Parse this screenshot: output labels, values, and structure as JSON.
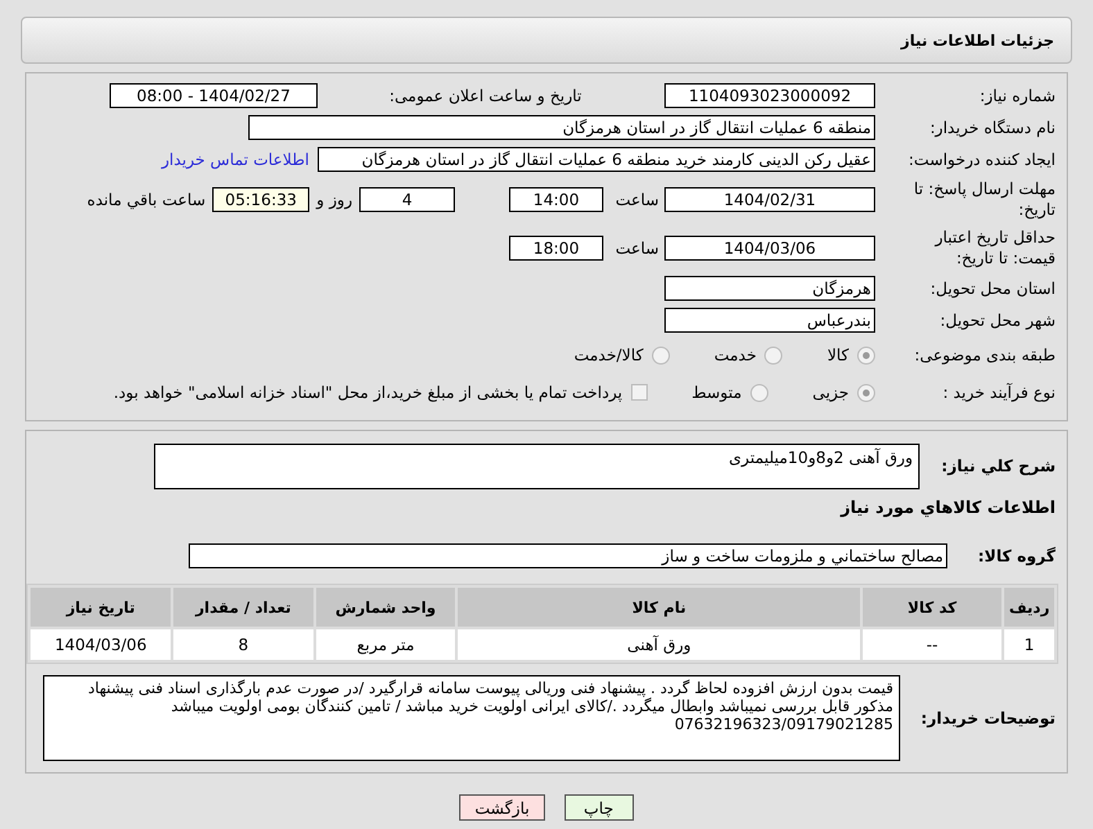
{
  "header": {
    "title": "جزئیات اطلاعات نیاز"
  },
  "need_number": {
    "label": "شماره نیاز:",
    "value": "1104093023000092"
  },
  "announce": {
    "label": "تاریخ و ساعت اعلان عمومی:",
    "value": "1404/02/27 - 08:00"
  },
  "buyer": {
    "label": "نام دستگاه خریدار:",
    "value": "منطقه 6 عملیات انتقال گاز در استان هرمزگان"
  },
  "requester": {
    "label": "ایجاد کننده درخواست:",
    "value": "عقیل رکن الدینی کارمند خرید منطقه 6 عملیات انتقال گاز در استان هرمزگان",
    "link": "اطلاعات تماس خریدار"
  },
  "reply_deadline": {
    "label": "مهلت ارسال پاسخ: تا تاریخ:",
    "date": "1404/02/31",
    "time_label": "ساعت",
    "time": "14:00",
    "days": "4",
    "days_label": "روز و",
    "remaining": "05:16:33",
    "remaining_label": "ساعت باقي مانده"
  },
  "price_validity": {
    "label": "حداقل تاریخ اعتبار قیمت: تا تاریخ:",
    "date": "1404/03/06",
    "time_label": "ساعت",
    "time": "18:00"
  },
  "province": {
    "label": "استان محل تحویل:",
    "value": "هرمزگان"
  },
  "city": {
    "label": "شهر محل تحویل:",
    "value": "بندرعباس"
  },
  "category": {
    "label": "طبقه بندی موضوعی:",
    "options": [
      {
        "label": "کالا",
        "selected": true
      },
      {
        "label": "خدمت",
        "selected": false
      },
      {
        "label": "کالا/خدمت",
        "selected": false
      }
    ]
  },
  "purchase_type": {
    "label": "نوع فرآیند خرید :",
    "options": [
      {
        "label": "جزیی",
        "selected": true
      },
      {
        "label": "متوسط",
        "selected": false
      }
    ],
    "payment": {
      "label": "پرداخت تمام یا بخشی از مبلغ خرید،از محل \"اسناد خزانه اسلامی\" خواهد بود.",
      "checked": false
    }
  },
  "description": {
    "label": "شرح كلي نياز:",
    "value": "ورق آهنی 2و8و10میلیمتری"
  },
  "goods_heading": "اطلاعات كالاهاي مورد نياز",
  "goods_group": {
    "label": "گروه كالا:",
    "value": "مصالح ساختماني و ملزومات ساخت و ساز"
  },
  "table": {
    "columns": [
      "رديف",
      "كد كالا",
      "نام كالا",
      "واحد شمارش",
      "تعداد / مقدار",
      "تاريخ نياز"
    ],
    "rows": [
      [
        "1",
        "--",
        "ورق آهنی",
        "متر مربع",
        "8",
        "1404/03/06"
      ]
    ]
  },
  "buyer_notes": {
    "label": "توضیحات خریدار:",
    "value": "قیمت بدون ارزش افزوده لحاظ گردد . پیشنهاد فنی وریالی پیوست سامانه قرارگیرد /در صورت عدم بارگذاری اسناد فنی پیشنهاد مذکور قابل بررسی نمیباشد وابطال میگردد ./کالای ایرانی اولویت خرید مباشد / تامین کنندگان بومی اولویت میباشد 07632196323/09179021285"
  },
  "buttons": [
    {
      "label": "چاپ",
      "kind": "print"
    },
    {
      "label": "بازگشت",
      "kind": "back"
    }
  ]
}
